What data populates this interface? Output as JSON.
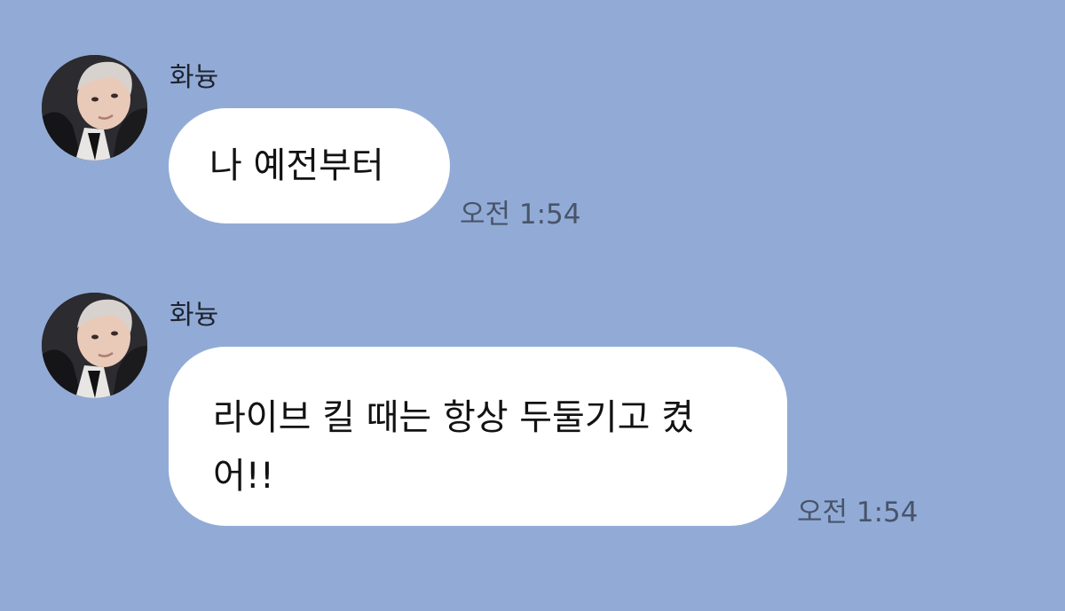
{
  "messages": [
    {
      "sender": "화늉",
      "text": "나 예전부터",
      "time": "오전 1:54"
    },
    {
      "sender": "화늉",
      "text": "라이브 킬 때는 항상 두둘기고 켰어!!",
      "time": "오전 1:54"
    }
  ],
  "colors": {
    "background": "#92abd6",
    "bubble": "#ffffff",
    "time_text": "#48546a"
  },
  "icons": {
    "avatar": "profile-photo"
  }
}
